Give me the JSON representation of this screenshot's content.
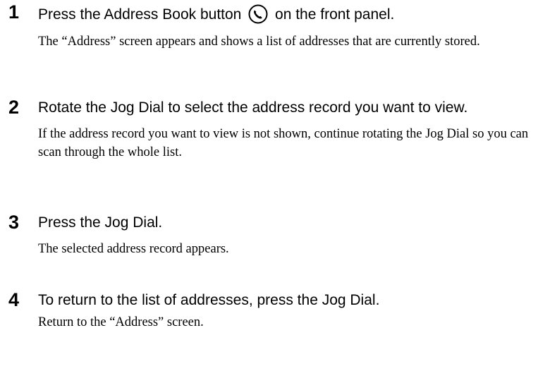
{
  "steps": [
    {
      "number": "1",
      "instruction_before_icon": "Press the Address Book button",
      "icon": "phone-handset-icon",
      "instruction_after_icon": "on the front panel.",
      "description": "The “Address” screen appears and shows a list of addresses that are currently stored."
    },
    {
      "number": "2",
      "instruction": "Rotate the Jog Dial to select the address record you want to view.",
      "description": "If the address record you want to view is not shown, continue rotating the Jog Dial so you can scan through the whole list."
    },
    {
      "number": "3",
      "instruction": "Press the Jog Dial.",
      "description": "The selected address record appears."
    },
    {
      "number": "4",
      "instruction": "To return to the list of addresses, press the Jog Dial.",
      "description": "Return to the “Address” screen."
    }
  ]
}
